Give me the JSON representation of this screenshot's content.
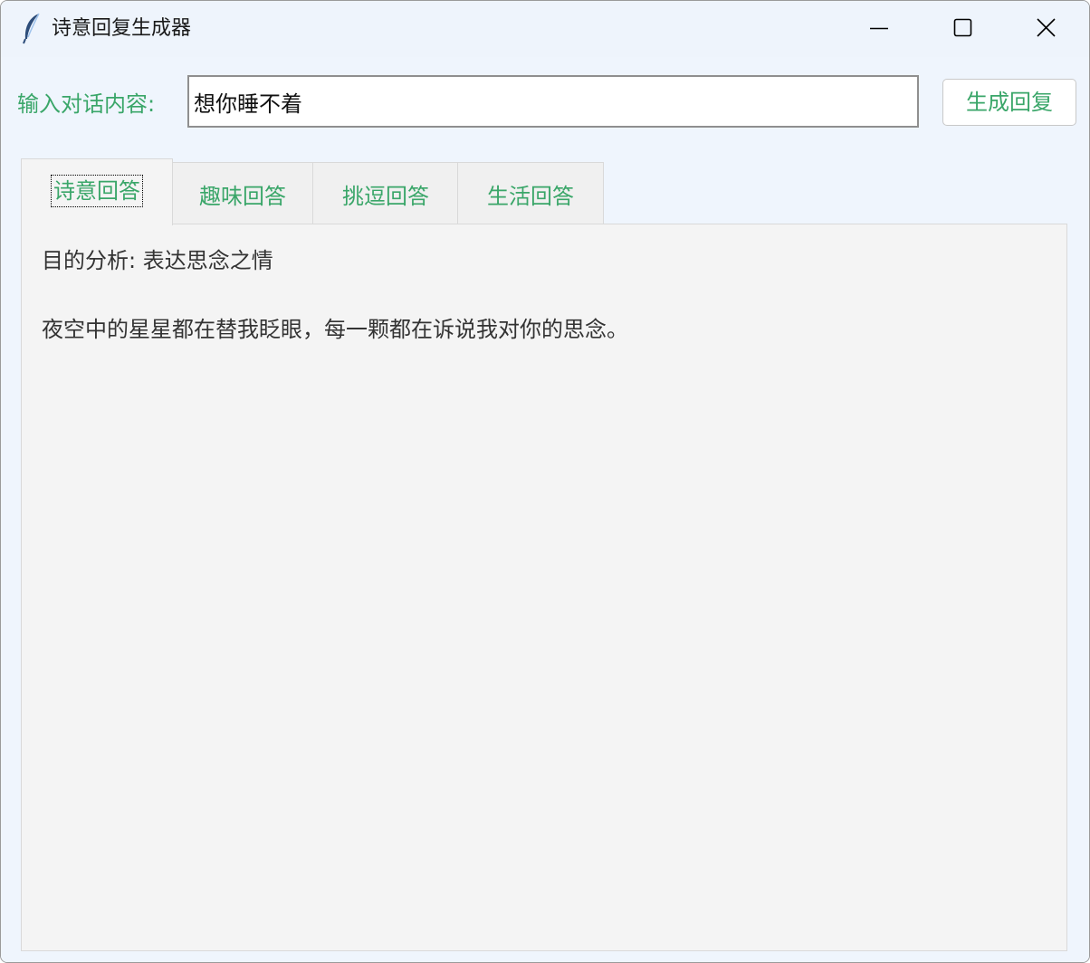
{
  "window": {
    "title": "诗意回复生成器",
    "icons": {
      "app": "feather-icon",
      "minimize": "minimize-icon",
      "maximize": "maximize-icon",
      "close": "close-icon"
    }
  },
  "input_row": {
    "label": "输入对话内容:",
    "value": "想你睡不着",
    "button_label": "生成回复"
  },
  "tabs": [
    {
      "label": "诗意回答",
      "active": true
    },
    {
      "label": "趣味回答",
      "active": false
    },
    {
      "label": "挑逗回答",
      "active": false
    },
    {
      "label": "生活回答",
      "active": false
    }
  ],
  "panel": {
    "analysis": "目的分析: 表达思念之情",
    "reply": "夜空中的星星都在替我眨眼，每一颗都在诉说我对你的思念。"
  },
  "colors": {
    "accent_green": "#3aa669",
    "window_bg": "#eff5fd",
    "panel_bg": "#f4f4f4"
  }
}
